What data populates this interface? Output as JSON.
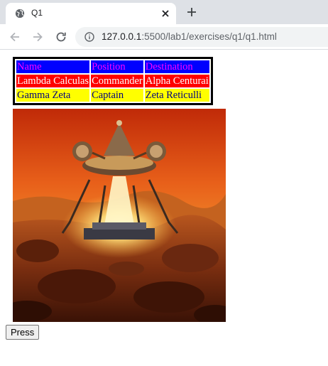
{
  "browser": {
    "tab_title": "Q1",
    "url_host": "127.0.0.1",
    "url_rest": ":5500/lab1/exercises/q1/q1.html"
  },
  "icons": {
    "tab_favicon": "globe-icon",
    "tab_close": "close-icon",
    "new_tab": "plus-icon",
    "back": "arrow-left-icon",
    "forward": "arrow-right-icon",
    "reload": "reload-icon",
    "site_info": "info-icon"
  },
  "table": {
    "headers": [
      "Name",
      "Position",
      "Destination"
    ],
    "rows": [
      [
        "Lambda Calculas",
        "Commander",
        "Alpha Centurai"
      ],
      [
        "Gamma Zeta",
        "Captain",
        "Zeta Reticulli"
      ]
    ]
  },
  "button": {
    "label": "Press"
  },
  "colors": {
    "header_bg": "#0000ff",
    "header_text": "#ff00ff",
    "row1_bg": "#ff0000",
    "row1_text": "#ffffff",
    "row2_bg": "#ffff00",
    "row2_text": "#000080"
  }
}
